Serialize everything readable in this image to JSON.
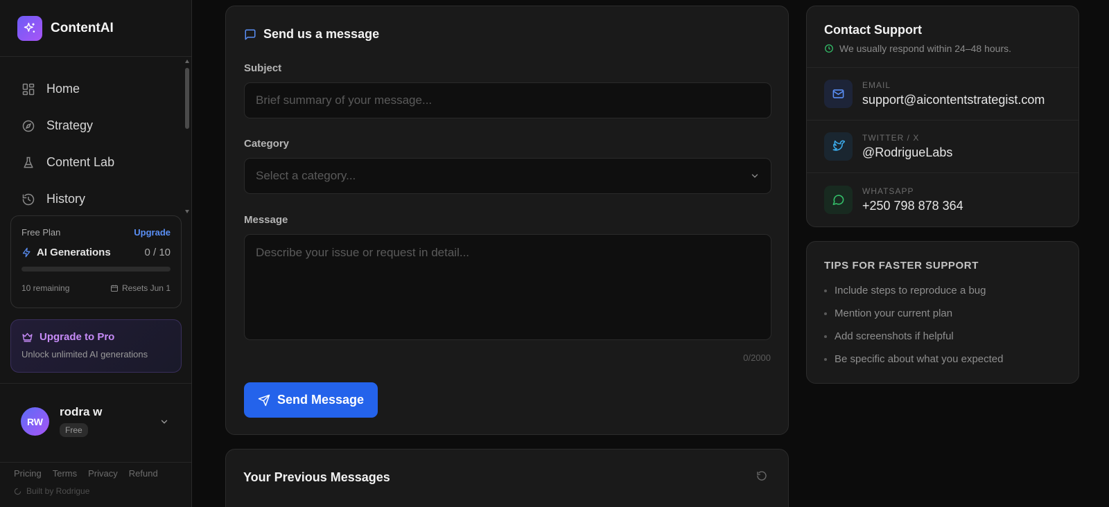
{
  "brand": {
    "name": "ContentAI"
  },
  "nav": [
    {
      "label": "Home",
      "icon": "grid-icon"
    },
    {
      "label": "Strategy",
      "icon": "compass-icon"
    },
    {
      "label": "Content Lab",
      "icon": "flask-icon"
    },
    {
      "label": "History",
      "icon": "history-icon"
    }
  ],
  "plan": {
    "name": "Free Plan",
    "upgrade_label": "Upgrade",
    "generations_label": "AI Generations",
    "usage": "0 / 10",
    "usage_fraction": 0,
    "remaining": "10 remaining",
    "resets": "Resets Jun 1"
  },
  "pro": {
    "title": "Upgrade to Pro",
    "subtitle": "Unlock unlimited AI generations"
  },
  "user": {
    "initials": "RW",
    "name": "rodra w",
    "badge": "Free"
  },
  "footer": {
    "links": [
      "Pricing",
      "Terms",
      "Privacy",
      "Refund"
    ],
    "built_by": "Built by Rodrigue"
  },
  "form": {
    "title": "Send us a message",
    "subject_label": "Subject",
    "subject_placeholder": "Brief summary of your message...",
    "category_label": "Category",
    "category_placeholder": "Select a category...",
    "message_label": "Message",
    "message_placeholder": "Describe your issue or request in detail...",
    "char_count": "0/2000",
    "send_label": "Send Message"
  },
  "previous": {
    "title": "Your Previous Messages"
  },
  "contact": {
    "title": "Contact Support",
    "subtitle": "We usually respond within 24–48 hours.",
    "channels": [
      {
        "label": "EMAIL",
        "value": "support@aicontentstrategist.com",
        "icon": "mail-icon",
        "color": "#5a8ff5"
      },
      {
        "label": "TWITTER / X",
        "value": "@RodrigueLabs",
        "icon": "twitter-icon",
        "color": "#3ba9e8"
      },
      {
        "label": "WHATSAPP",
        "value": "+250 798 878 364",
        "icon": "whatsapp-icon",
        "color": "#34c06a"
      }
    ]
  },
  "tips": {
    "title": "TIPS FOR FASTER SUPPORT",
    "items": [
      "Include steps to reproduce a bug",
      "Mention your current plan",
      "Add screenshots if helpful",
      "Be specific about what you expected"
    ]
  },
  "colors": {
    "accent": "#2463eb",
    "link": "#5a8ff5",
    "pro": "#c68bf7",
    "success": "#34c06a",
    "background": "#0c0c0c",
    "card": "#1a1a1a"
  }
}
